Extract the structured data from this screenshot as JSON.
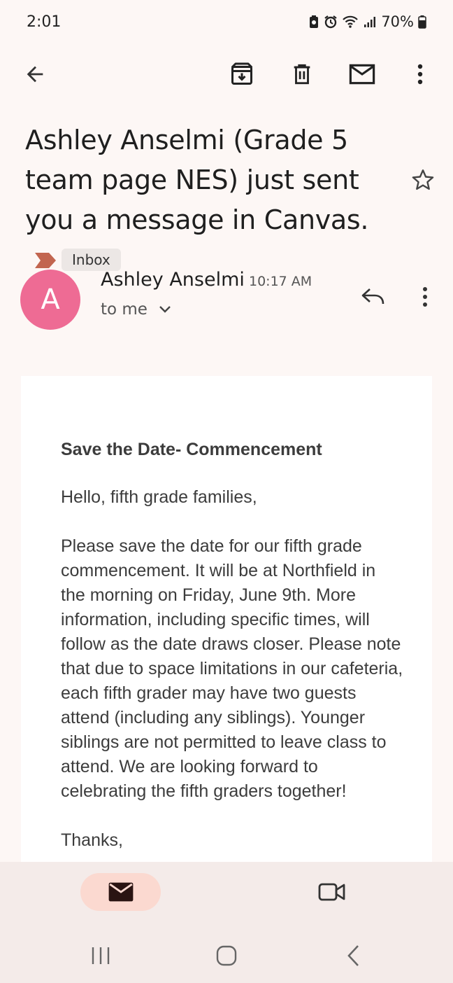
{
  "status_bar": {
    "time": "2:01",
    "battery": "70%",
    "icons": [
      "battery-saver-icon",
      "alarm-icon",
      "wifi-icon",
      "signal-icon",
      "battery-icon"
    ]
  },
  "toolbar": {
    "icons": [
      "back-arrow-icon",
      "archive-icon",
      "delete-icon",
      "mark-unread-icon",
      "more-vert-icon"
    ]
  },
  "email": {
    "subject": "Ashley Anselmi (Grade 5 team page NES) just sent you a message in Canvas.",
    "label": "Inbox",
    "label_marker_color": "#c2654f",
    "sender": {
      "initial": "A",
      "name": "Ashley Anselmi",
      "time": "10:17 AM",
      "recipient": "to me",
      "avatar_color": "#ee6b94"
    },
    "body": {
      "title": "Save the Date- Commencement",
      "greeting": "Hello, fifth grade families,",
      "paragraph": "Please save the date for our fifth grade commencement. It will be at Northfield in the morning on Friday, June 9th. More information, including specific times, will follow as the date draws closer. Please note that due to space limitations in our cafeteria, each fifth grader may have two guests attend (including any siblings). Younger siblings are not permitted to leave class to attend. We are looking forward to celebrating the fifth graders together!",
      "closing": "Thanks,"
    }
  },
  "bottom_nav": {
    "items": [
      "mail-icon",
      "video-camera-icon"
    ],
    "active": "mail",
    "active_pill_color": "#fbd9d0"
  },
  "system_nav": {
    "items": [
      "recents-icon",
      "home-icon",
      "back-icon"
    ]
  }
}
